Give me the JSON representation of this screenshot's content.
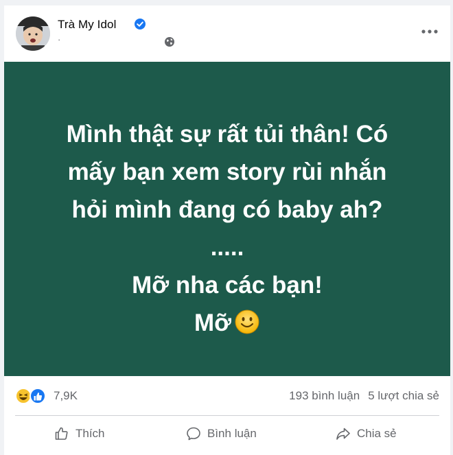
{
  "post": {
    "author": "Trà My Idol",
    "verified": true,
    "time_text": "·",
    "audience_icon": "globe-icon",
    "more_icon": "more-options-icon",
    "background_color": "#1d5a4b",
    "text_lines": [
      "Mình thật sự rất tủi thân! Có",
      "mấy bạn xem story rùi nhắn",
      "hỏi mình đang có baby ah?",
      ".....",
      "Mỡ nha các bạn!",
      "Mỡ"
    ],
    "trailing_emoji": "slightly-smiling-face"
  },
  "stats": {
    "reaction_icons": [
      "haha-icon",
      "like-icon"
    ],
    "reactions": "7,9K",
    "comments": "193 bình luận",
    "shares": "5 lượt chia sẻ"
  },
  "actions": {
    "like": "Thích",
    "comment": "Bình luận",
    "share": "Chia sẻ"
  },
  "colors": {
    "accent": "#1877f2",
    "muted_text": "#65676b"
  }
}
